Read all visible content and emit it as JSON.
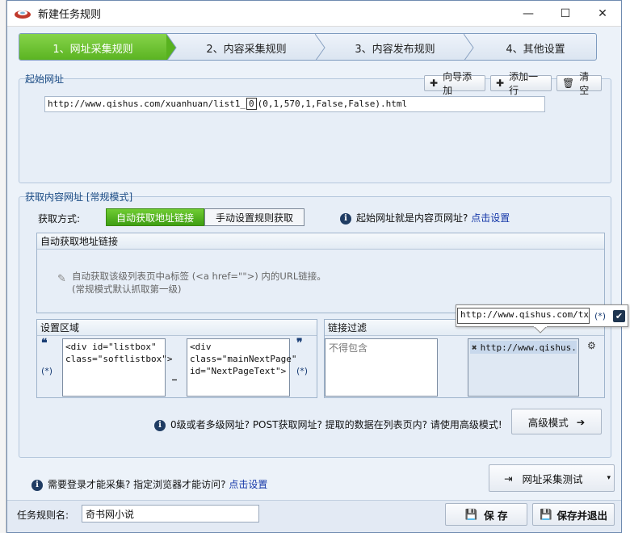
{
  "window": {
    "title": "新建任务规则",
    "minimize": "—",
    "maximize": "☐",
    "close": "✕"
  },
  "steps": [
    {
      "label": "1、网址采集规则",
      "active": true
    },
    {
      "label": "2、内容采集规则",
      "active": false
    },
    {
      "label": "3、内容发布规则",
      "active": false
    },
    {
      "label": "4、其他设置",
      "active": false
    }
  ],
  "start_url": {
    "title": "起始网址",
    "wizard_add": "向导添加",
    "add_line": "添加一行",
    "clear": "清空",
    "url_prefix": "http://www.qishus.com/xuanhuan/list1_",
    "url_token": "0",
    "url_suffix": "(0,1,570,1,False,False).html"
  },
  "fetch": {
    "title": "获取内容网址 [常规模式]",
    "method_label": "获取方式:",
    "auto_option": "自动获取地址链接",
    "manual_option": "手动设置规则获取",
    "start_is_content_q": "起始网址就是内容页网址?",
    "click_set": "点击设置",
    "auto_box_title": "自动获取地址链接",
    "auto_hint_line1": "自动获取该级列表页中a标签 (<a href=\"\">) 内的URL链接。",
    "auto_hint_line2": "(常规模式默认抓取第一级)",
    "region_title": "设置区域",
    "open_quote": "❝",
    "close_quote": "❞",
    "star_left": "(*)",
    "star_right": "(*)",
    "region_start": "<div id=\"listbox\"\nclass=\"softlistbox\">",
    "region_end": "<div\nclass=\"mainNextPage\"\nid=\"NextPageText\">",
    "underscore": "_",
    "filter_title": "链接过滤",
    "exclude_placeholder": "不得包含",
    "include_item": "http://www.qishus.co",
    "tooltip_value": "http://www.qishus.com/txt/",
    "tooltip_star": "(*)",
    "advanced_question": "0级或者多级网址? POST获取网址? 提取的数据在列表页内? 请使用高级模式!",
    "advanced_button": "高级模式"
  },
  "footer": {
    "login_question": "需要登录才能采集? 指定浏览器才能访问?",
    "click_set": "点击设置",
    "test_button": "网址采集测试",
    "rule_name_label": "任务规则名:",
    "rule_name_value": "奇书网小说",
    "save": "保 存",
    "save_exit": "保存并退出"
  },
  "colors": {
    "active_step": "#58b21f",
    "link": "#1437a8",
    "section_title": "#1d4d86"
  }
}
